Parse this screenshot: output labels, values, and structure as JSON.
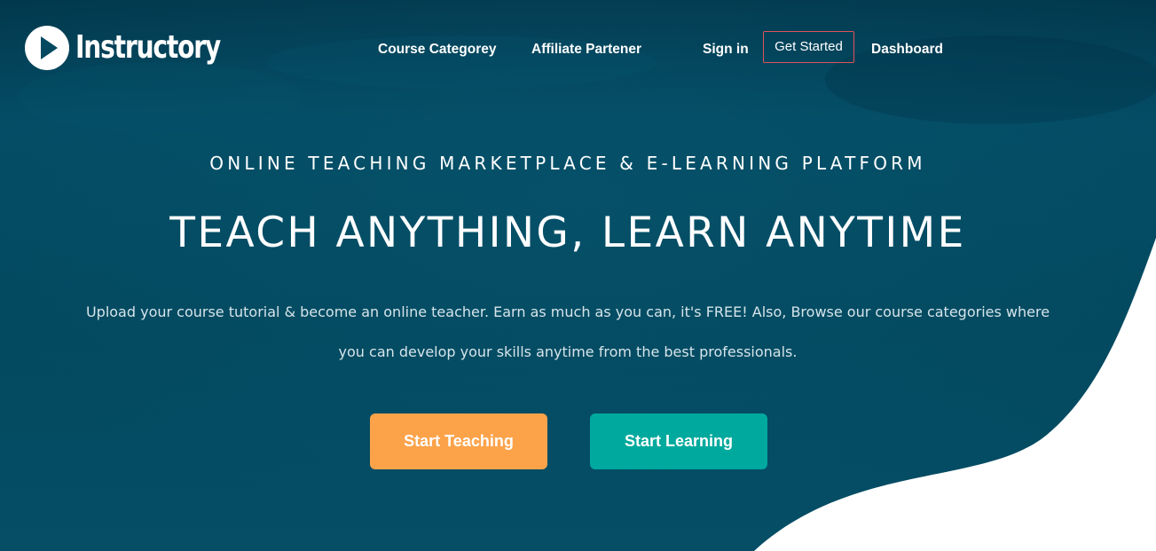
{
  "brand": {
    "name": "Instructory",
    "icon": "play-circle-icon"
  },
  "nav": {
    "course_category": "Course Categorey",
    "affiliate_partner": "Affiliate Partener",
    "sign_in": "Sign in",
    "get_started": "Get Started",
    "dashboard": "Dashboard"
  },
  "hero": {
    "eyebrow": "ONLINE TEACHING MARKETPLACE & E-LEARNING PLATFORM",
    "headline": "TEACH ANYTHING, LEARN ANYTIME",
    "subtext": "Upload your course tutorial & become an online teacher. Earn as much as you can, it's FREE! Also, Browse our course categories where you can develop your skills anytime from the best professionals.",
    "cta_teach": "Start Teaching",
    "cta_learn": "Start Learning"
  },
  "colors": {
    "hero_background": "#03495f",
    "hero_background_dark": "#02384d",
    "get_started_border": "#e0525a",
    "start_teaching": "#fca34a",
    "start_learning": "#00a99d"
  }
}
